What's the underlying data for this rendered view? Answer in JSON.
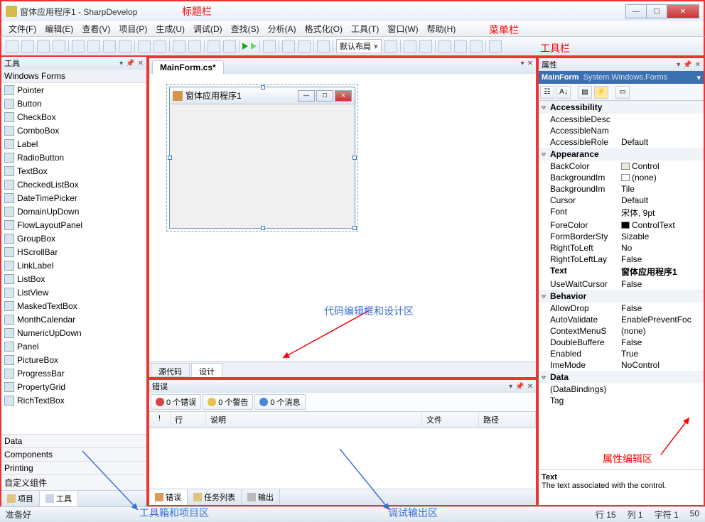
{
  "annotations": {
    "title_bar": "标题栏",
    "menu_bar": "菜单栏",
    "tool_bar": "工具栏",
    "code_design": "代码编辑框和设计区",
    "toolbox_project": "工具箱和项目区",
    "debug_output": "调试输出区",
    "property_edit": "属性编辑区"
  },
  "window": {
    "title": "窗体应用程序1 - SharpDevelop"
  },
  "menus": [
    "文件(F)",
    "编辑(E)",
    "查看(V)",
    "项目(P)",
    "生成(U)",
    "调试(D)",
    "查找(S)",
    "分析(A)",
    "格式化(O)",
    "工具(T)",
    "窗口(W)",
    "帮助(H)"
  ],
  "toolbar": {
    "layout_combo": "默认布局"
  },
  "left": {
    "panel_title": "工具",
    "category": "Windows Forms",
    "items": [
      "Pointer",
      "Button",
      "CheckBox",
      "ComboBox",
      "Label",
      "RadioButton",
      "TextBox",
      "CheckedListBox",
      "DateTimePicker",
      "DomainUpDown",
      "FlowLayoutPanel",
      "GroupBox",
      "HScrollBar",
      "LinkLabel",
      "ListBox",
      "ListView",
      "MaskedTextBox",
      "MonthCalendar",
      "NumericUpDown",
      "Panel",
      "PictureBox",
      "ProgressBar",
      "PropertyGrid",
      "RichTextBox"
    ],
    "groups": [
      "Data",
      "Components",
      "Printing",
      "自定义组件"
    ],
    "bottom_tabs": {
      "project": "项目",
      "tools": "工具"
    }
  },
  "center": {
    "doc_tab": "MainForm.cs*",
    "form_caption": "窗体应用程序1",
    "mode_tabs": {
      "source": "源代码",
      "design": "设计"
    }
  },
  "errors": {
    "title": "错误",
    "err": "0 个错误",
    "warn": "0 个警告",
    "msg": "0 个消息",
    "columns": {
      "ex": "!",
      "line": "行",
      "desc": "说明",
      "file": "文件",
      "path": "路径"
    },
    "bottom_tabs": {
      "errors": "错误",
      "tasks": "任务列表",
      "output": "输出"
    }
  },
  "props": {
    "title": "属性",
    "object": "MainForm",
    "type": "System.Windows.Forms",
    "cats": {
      "acc": "Accessibility",
      "app": "Appearance",
      "beh": "Behavior",
      "dat": "Data"
    },
    "rows": {
      "AccessibleDesc": "AccessibleDesc",
      "AccessibleName": "AccessibleNam",
      "AccessibleRole": "AccessibleRole",
      "AccessibleRole_v": "Default",
      "BackColor": "BackColor",
      "BackColor_v": "Control",
      "BackgroundIm": "BackgroundIm",
      "BackgroundIm_v": "(none)",
      "BackgroundImT": "BackgroundIm",
      "BackgroundImT_v": "Tile",
      "Cursor": "Cursor",
      "Cursor_v": "Default",
      "Font": "Font",
      "Font_v": "宋体, 9pt",
      "ForeColor": "ForeColor",
      "ForeColor_v": "ControlText",
      "FormBorderSt": "FormBorderSty",
      "FormBorderSt_v": "Sizable",
      "RightToLeft": "RightToLeft",
      "RightToLeft_v": "No",
      "RightToLeftLay": "RightToLeftLay",
      "RightToLeftLay_v": "False",
      "Text": "Text",
      "Text_v": "窗体应用程序1",
      "UseWaitCursor": "UseWaitCursor",
      "UseWaitCursor_v": "False",
      "AllowDrop": "AllowDrop",
      "AllowDrop_v": "False",
      "AutoValidate": "AutoValidate",
      "AutoValidate_v": "EnablePreventFoc",
      "ContextMenuS": "ContextMenuS",
      "ContextMenuS_v": "(none)",
      "DoubleBuffere": "DoubleBuffere",
      "DoubleBuffere_v": "False",
      "Enabled": "Enabled",
      "Enabled_v": "True",
      "ImeMode": "ImeMode",
      "ImeMode_v": "NoControl",
      "DataBindings": "(DataBindings)",
      "Tag": "Tag"
    },
    "desc_title": "Text",
    "desc_body": "The text associated with the control."
  },
  "status": {
    "ready": "准备好",
    "line_lbl": "行",
    "line_v": "15",
    "col_lbl": "列",
    "col_v": "1",
    "char_lbl": "字符",
    "char_v": "1",
    "last": "50"
  }
}
